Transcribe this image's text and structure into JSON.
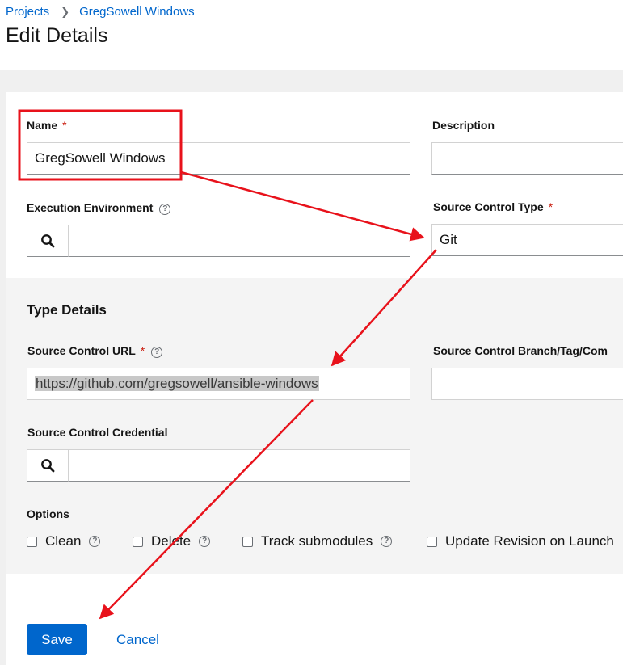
{
  "breadcrumb": {
    "projects": "Projects",
    "current": "GregSowell Windows"
  },
  "page_title": "Edit Details",
  "form": {
    "name": {
      "label": "Name",
      "required_mark": "*",
      "value": "GregSowell Windows"
    },
    "description": {
      "label": "Description",
      "value": ""
    },
    "execution_environment": {
      "label": "Execution Environment",
      "value": ""
    },
    "source_control_type": {
      "label": "Source Control Type",
      "required_mark": "*",
      "value": "Git"
    }
  },
  "type_details": {
    "title": "Type Details",
    "source_control_url": {
      "label": "Source Control URL",
      "required_mark": "*",
      "value": "https://github.com/gregsowell/ansible-windows"
    },
    "source_control_branch": {
      "label": "Source Control Branch/Tag/Com",
      "value": ""
    },
    "source_control_credential": {
      "label": "Source Control Credential",
      "value": ""
    },
    "options": {
      "label": "Options",
      "items": [
        {
          "label": "Clean",
          "checked": false
        },
        {
          "label": "Delete",
          "checked": false
        },
        {
          "label": "Track submodules",
          "checked": false
        },
        {
          "label": "Update Revision on Launch",
          "checked": false
        }
      ]
    }
  },
  "actions": {
    "save": "Save",
    "cancel": "Cancel"
  },
  "colors": {
    "link": "#0066cc",
    "primary": "#0066cc",
    "required": "#c9190b",
    "annotation": "#e8121b"
  },
  "icons": {
    "help": "question-circle-icon",
    "search": "search-icon"
  }
}
